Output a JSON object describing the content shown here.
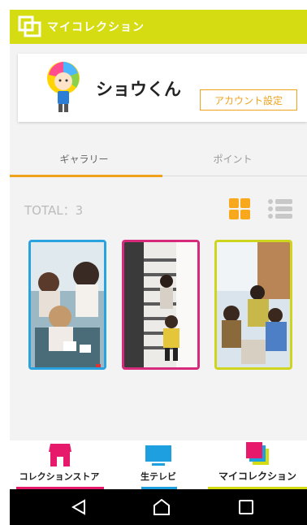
{
  "header": {
    "title": "マイコレクション"
  },
  "profile": {
    "username": "ショウくん",
    "account_button": "アカウント設定"
  },
  "tabs": [
    {
      "label": "ギャラリー",
      "active": true
    },
    {
      "label": "ポイント",
      "active": false
    }
  ],
  "gallery": {
    "total_label": "TOTAL：3",
    "view_mode": "grid"
  },
  "photos": [
    {
      "frame_color": "#29a3e0"
    },
    {
      "frame_color": "#d62b7c"
    },
    {
      "frame_color": "#cfd51e"
    }
  ],
  "bottom_nav": [
    {
      "label": "コレクションストア",
      "icon": "shop-icon",
      "color": "#e6196b"
    },
    {
      "label": "生テレビ",
      "icon": "tv-icon",
      "color": "#1e9fe0"
    },
    {
      "label": "マイコレクション",
      "icon": "collection-icon",
      "color": "#d6dc12"
    }
  ],
  "system_nav": {
    "back": "back-icon",
    "home": "home-icon",
    "recents": "recents-icon"
  },
  "colors": {
    "accent": "#f0a21c",
    "header": "#d6dc12"
  }
}
